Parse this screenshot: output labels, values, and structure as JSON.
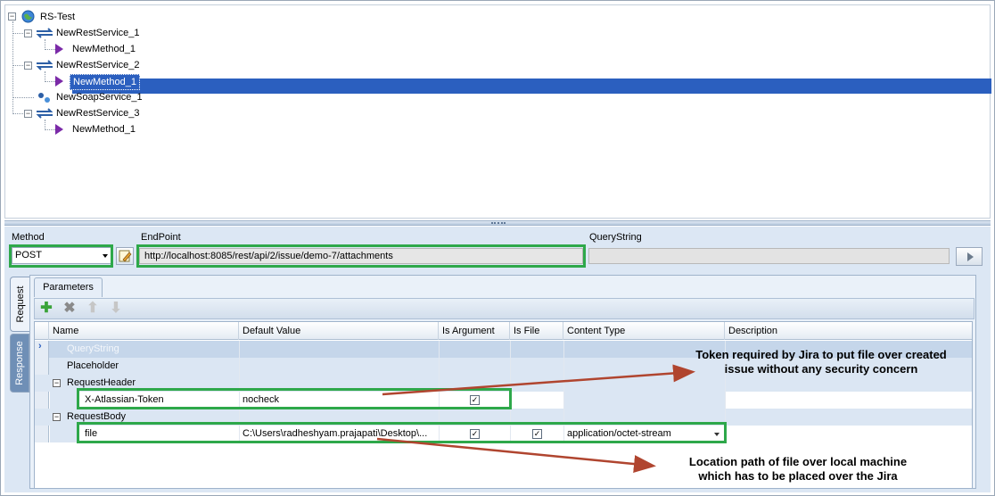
{
  "tree": {
    "root": "RS-Test",
    "items": [
      {
        "label": "NewRestService_1"
      },
      {
        "label": "NewMethod_1"
      },
      {
        "label": "NewRestService_2"
      },
      {
        "label": "NewMethod_1"
      },
      {
        "label": "NewSoapService_1"
      },
      {
        "label": "NewRestService_3"
      },
      {
        "label": "NewMethod_1"
      }
    ]
  },
  "request_bar": {
    "method_label": "Method",
    "method_value": "POST",
    "endpoint_label": "EndPoint",
    "endpoint_value": "http://localhost:8085/rest/api/2/issue/demo-7/attachments",
    "querystring_label": "QueryString",
    "querystring_value": ""
  },
  "side_tabs": {
    "request": "Request",
    "response": "Response"
  },
  "params_tab": "Parameters",
  "toolbar": {
    "icons": [
      "add-icon",
      "delete-icon",
      "move-up-icon",
      "move-down-icon"
    ]
  },
  "grid": {
    "columns": [
      "Name",
      "Default Value",
      "Is Argument",
      "Is File",
      "Content Type",
      "Description"
    ],
    "rows": [
      {
        "name": "QueryString"
      },
      {
        "name": "Placeholder"
      },
      {
        "name": "RequestHeader"
      },
      {
        "name": "X-Atlassian-Token",
        "default": "nocheck",
        "is_argument": true,
        "is_file": false,
        "content_type": "",
        "description": ""
      },
      {
        "name": "RequestBody"
      },
      {
        "name": "file",
        "default": "C:\\Users\\radheshyam.prajapati\\Desktop\\...",
        "is_argument": true,
        "is_file": true,
        "content_type": "application/octet-stream",
        "description": ""
      }
    ]
  },
  "annotations": {
    "token_note_1": "Token required by Jira to put file over created",
    "token_note_2": "issue without any security concern",
    "path_note_1": "Location path of file over local machine",
    "path_note_2": "which has to be placed over the Jira"
  },
  "colors": {
    "highlight_green": "#2ea84a",
    "arrow_red": "#b0452f",
    "selection_blue": "#2b5fbf"
  }
}
